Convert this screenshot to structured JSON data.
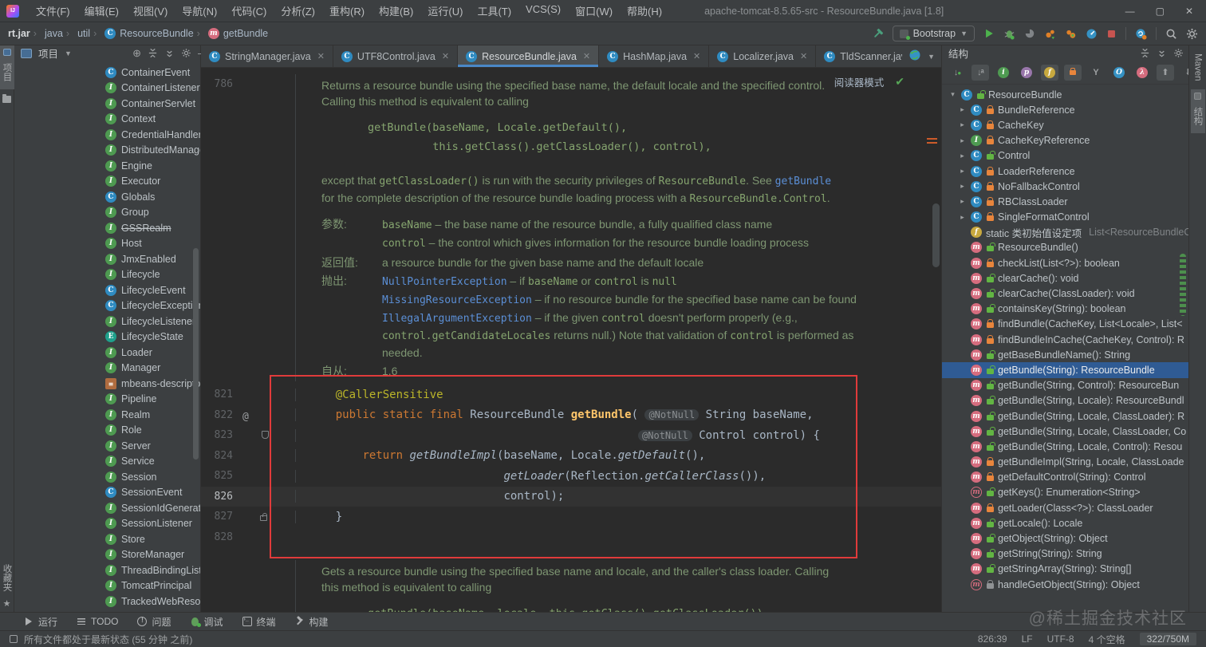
{
  "window": {
    "logo": "IJ",
    "menus": [
      "文件(F)",
      "编辑(E)",
      "视图(V)",
      "导航(N)",
      "代码(C)",
      "分析(Z)",
      "重构(R)",
      "构建(B)",
      "运行(U)",
      "工具(T)",
      "VCS(S)",
      "窗口(W)",
      "帮助(H)"
    ],
    "title": "apache-tomcat-8.5.65-src - ResourceBundle.java [1.8]",
    "controls": {
      "minimize": "—",
      "maximize": "▢",
      "close": "✕"
    }
  },
  "navbar": {
    "crumbs": [
      {
        "label": "rt.jar",
        "icon": ""
      },
      {
        "label": "java",
        "icon": ""
      },
      {
        "label": "util",
        "icon": ""
      },
      {
        "label": "ResourceBundle",
        "icon": "cls"
      },
      {
        "label": "getBundle",
        "icon": "mth"
      }
    ],
    "run_config": "Bootstrap"
  },
  "left_stripe": {
    "project": "项目",
    "favorites": "收藏夹"
  },
  "right_stripe": {
    "maven": "Maven",
    "structure": "结构"
  },
  "project_panel": {
    "title": "项目"
  },
  "project_tree": {
    "items": [
      {
        "label": "ContainerEvent",
        "kind": "cls"
      },
      {
        "label": "ContainerListener",
        "kind": "ifc"
      },
      {
        "label": "ContainerServlet",
        "kind": "ifc"
      },
      {
        "label": "Context",
        "kind": "ifc"
      },
      {
        "label": "CredentialHandler",
        "kind": "ifc"
      },
      {
        "label": "DistributedManager",
        "kind": "ifc"
      },
      {
        "label": "Engine",
        "kind": "ifc"
      },
      {
        "label": "Executor",
        "kind": "ifc"
      },
      {
        "label": "Globals",
        "kind": "cls"
      },
      {
        "label": "Group",
        "kind": "ifc"
      },
      {
        "label": "GSSRealm",
        "kind": "ifc",
        "deprecated": true
      },
      {
        "label": "Host",
        "kind": "ifc"
      },
      {
        "label": "JmxEnabled",
        "kind": "ifc"
      },
      {
        "label": "Lifecycle",
        "kind": "ifc"
      },
      {
        "label": "LifecycleEvent",
        "kind": "cls"
      },
      {
        "label": "LifecycleException",
        "kind": "cls"
      },
      {
        "label": "LifecycleListener",
        "kind": "ifc"
      },
      {
        "label": "LifecycleState",
        "kind": "enm"
      },
      {
        "label": "Loader",
        "kind": "ifc"
      },
      {
        "label": "Manager",
        "kind": "ifc"
      },
      {
        "label": "mbeans-descriptors",
        "kind": "xml"
      },
      {
        "label": "Pipeline",
        "kind": "ifc"
      },
      {
        "label": "Realm",
        "kind": "ifc"
      },
      {
        "label": "Role",
        "kind": "ifc"
      },
      {
        "label": "Server",
        "kind": "ifc"
      },
      {
        "label": "Service",
        "kind": "ifc"
      },
      {
        "label": "Session",
        "kind": "ifc"
      },
      {
        "label": "SessionEvent",
        "kind": "cls"
      },
      {
        "label": "SessionIdGenerator",
        "kind": "ifc"
      },
      {
        "label": "SessionListener",
        "kind": "ifc"
      },
      {
        "label": "Store",
        "kind": "ifc"
      },
      {
        "label": "StoreManager",
        "kind": "ifc"
      },
      {
        "label": "ThreadBindingListener",
        "kind": "ifc"
      },
      {
        "label": "TomcatPrincipal",
        "kind": "ifc"
      },
      {
        "label": "TrackedWebResource",
        "kind": "ifc"
      }
    ]
  },
  "tabs": {
    "items": [
      {
        "label": "StringManager.java",
        "active": false
      },
      {
        "label": "UTF8Control.java",
        "active": false
      },
      {
        "label": "ResourceBundle.java",
        "active": true
      },
      {
        "label": "HashMap.java",
        "active": false
      },
      {
        "label": "Localizer.java",
        "active": false
      },
      {
        "label": "TldScanner.java",
        "active": false
      }
    ]
  },
  "structure_panel": {
    "title": "结构"
  },
  "editor": {
    "reader_mode_label": "阅读器模式",
    "first_line_num": "786",
    "doc1": {
      "para1": [
        {
          "t": "Returns a resource bundle using the specified base name, the default locale and the specified control. Calling this method is equivalent to calling",
          "c": "p"
        }
      ],
      "codeblock": "getBundle(baseName, Locale.getDefault(),\n          this.getClass().getClassLoader(), control),",
      "para2": [
        {
          "t": "except that ",
          "c": "p"
        },
        {
          "t": "getClassLoader()",
          "c": "c"
        },
        {
          "t": " is run with the security privileges of ",
          "c": "p"
        },
        {
          "t": "ResourceBundle",
          "c": "c"
        },
        {
          "t": ". See ",
          "c": "p"
        },
        {
          "t": "getBundle",
          "c": "l"
        },
        {
          "t": " for the complete description of the resource bundle loading process with a ",
          "c": "p"
        },
        {
          "t": "ResourceBundle.Control",
          "c": "c"
        },
        {
          "t": ".",
          "c": "p"
        }
      ],
      "sections": [
        {
          "label": "参数:",
          "lines": [
            [
              {
                "t": "baseName",
                "c": "c"
              },
              {
                "t": " – the base name of the resource bundle, a fully qualified class name",
                "c": "p"
              }
            ],
            [
              {
                "t": "control",
                "c": "c"
              },
              {
                "t": " – the control which gives information for the resource bundle loading process",
                "c": "p"
              }
            ]
          ]
        },
        {
          "label": "返回值:",
          "lines": [
            [
              {
                "t": "a resource bundle for the given base name and the default locale",
                "c": "p"
              }
            ]
          ]
        },
        {
          "label": "抛出:",
          "lines": [
            [
              {
                "t": "NullPointerException",
                "c": "l"
              },
              {
                "t": " – if ",
                "c": "p"
              },
              {
                "t": "baseName",
                "c": "c"
              },
              {
                "t": " or ",
                "c": "p"
              },
              {
                "t": "control",
                "c": "c"
              },
              {
                "t": " is ",
                "c": "p"
              },
              {
                "t": "null",
                "c": "c"
              }
            ],
            [
              {
                "t": "MissingResourceException",
                "c": "l"
              },
              {
                "t": " – if no resource bundle for the specified base name can be found",
                "c": "p"
              }
            ],
            [
              {
                "t": "IllegalArgumentException",
                "c": "l"
              },
              {
                "t": " – if the given ",
                "c": "p"
              },
              {
                "t": "control",
                "c": "c"
              },
              {
                "t": " doesn't perform properly (e.g., ",
                "c": "p"
              },
              {
                "t": "control.getCandidateLocales",
                "c": "c"
              },
              {
                "t": " returns null.) Note that validation of ",
                "c": "p"
              },
              {
                "t": "control",
                "c": "c"
              },
              {
                "t": " is performed as needed.",
                "c": "p"
              }
            ]
          ]
        },
        {
          "label": "自从:",
          "lines": [
            [
              {
                "t": "1.6",
                "c": "p"
              }
            ]
          ]
        }
      ]
    },
    "code": {
      "lines": [
        {
          "num": "821",
          "tokens": [
            {
              "t": "    ",
              "c": "pl"
            },
            {
              "t": "@CallerSensitive",
              "c": "ann"
            }
          ]
        },
        {
          "num": "822",
          "gicon": "at",
          "tokens": [
            {
              "t": "    ",
              "c": "pl"
            },
            {
              "t": "public static final",
              "c": "k"
            },
            {
              "t": " ResourceBundle ",
              "c": "pl"
            },
            {
              "t": "getBundle",
              "c": "m"
            },
            {
              "t": "( ",
              "c": "pl"
            },
            {
              "t": "@NotNull",
              "c": "inlay"
            },
            {
              "t": " String baseName,",
              "c": "pl"
            }
          ]
        },
        {
          "num": "823",
          "gicon": "bm",
          "tokens": [
            {
              "t": "                                                 ",
              "c": "pl"
            },
            {
              "t": "@NotNull",
              "c": "inlay"
            },
            {
              "t": " Control control) {",
              "c": "pl"
            }
          ]
        },
        {
          "num": "824",
          "tokens": [
            {
              "t": "        ",
              "c": "pl"
            },
            {
              "t": "return ",
              "c": "k"
            },
            {
              "t": "getBundleImpl",
              "c": "sm"
            },
            {
              "t": "(baseName, Locale.",
              "c": "pl"
            },
            {
              "t": "getDefault",
              "c": "sm"
            },
            {
              "t": "(),",
              "c": "pl"
            }
          ]
        },
        {
          "num": "825",
          "tokens": [
            {
              "t": "                             ",
              "c": "pl"
            },
            {
              "t": "getLoader",
              "c": "sm"
            },
            {
              "t": "(Reflection.",
              "c": "pl"
            },
            {
              "t": "getCallerClass",
              "c": "sm"
            },
            {
              "t": "()),",
              "c": "pl"
            }
          ]
        },
        {
          "num": "826",
          "current": true,
          "tokens": [
            {
              "t": "                             ",
              "c": "pl"
            },
            {
              "t": "control);",
              "c": "pl"
            }
          ]
        },
        {
          "num": "827",
          "gicon": "lock",
          "tokens": [
            {
              "t": "    }",
              "c": "pl"
            }
          ]
        },
        {
          "num": "828",
          "tokens": []
        }
      ]
    },
    "doc2": {
      "para": [
        {
          "t": "Gets a resource bundle using the specified base name and locale, and the caller's class loader. Calling this method is equivalent to calling",
          "c": "p"
        }
      ],
      "codeblock": "getBundle(baseName, locale, this.getClass().getClassLoader()),"
    }
  },
  "structure_tree": {
    "rows": [
      {
        "a": "exp",
        "k": "cls",
        "vis": "pub",
        "label": "ResourceBundle"
      },
      {
        "a": "col",
        "lvl": 2,
        "k": "cls",
        "vis": "priv",
        "label": "BundleReference"
      },
      {
        "a": "col",
        "lvl": 2,
        "k": "cls",
        "vis": "priv",
        "label": "CacheKey"
      },
      {
        "a": "col",
        "lvl": 2,
        "k": "ifc",
        "vis": "priv",
        "label": "CacheKeyReference"
      },
      {
        "a": "col",
        "lvl": 2,
        "k": "cls",
        "vis": "pub",
        "label": "Control"
      },
      {
        "a": "col",
        "lvl": 2,
        "k": "cls",
        "vis": "priv",
        "label": "LoaderReference"
      },
      {
        "a": "col",
        "lvl": 2,
        "k": "cls",
        "vis": "priv",
        "label": "NoFallbackControl"
      },
      {
        "a": "col",
        "lvl": 2,
        "k": "cls",
        "vis": "priv",
        "label": "RBClassLoader"
      },
      {
        "a": "col",
        "lvl": 2,
        "k": "cls",
        "vis": "priv",
        "label": "SingleFormatControl"
      },
      {
        "a": "",
        "lvl": 2,
        "k": "ini",
        "vis": "none",
        "label": "static 类初始值设定项",
        "suffix": "List<ResourceBundleC"
      },
      {
        "a": "",
        "lvl": 2,
        "k": "mth",
        "vis": "pub",
        "label": "ResourceBundle()"
      },
      {
        "a": "",
        "lvl": 2,
        "k": "mth",
        "vis": "priv",
        "label": "checkList(List<?>): boolean"
      },
      {
        "a": "",
        "lvl": 2,
        "k": "mth",
        "vis": "pub",
        "label": "clearCache(): void"
      },
      {
        "a": "",
        "lvl": 2,
        "k": "mth",
        "vis": "pub",
        "label": "clearCache(ClassLoader): void"
      },
      {
        "a": "",
        "lvl": 2,
        "k": "mth",
        "vis": "pub",
        "label": "containsKey(String): boolean"
      },
      {
        "a": "",
        "lvl": 2,
        "k": "mth",
        "vis": "priv",
        "label": "findBundle(CacheKey, List<Locale>, List<"
      },
      {
        "a": "",
        "lvl": 2,
        "k": "mth",
        "vis": "priv",
        "label": "findBundleInCache(CacheKey, Control): R"
      },
      {
        "a": "",
        "lvl": 2,
        "k": "mth",
        "vis": "pub",
        "label": "getBaseBundleName(): String"
      },
      {
        "a": "",
        "lvl": 2,
        "k": "mth",
        "vis": "pub",
        "label": "getBundle(String): ResourceBundle",
        "sel": true
      },
      {
        "a": "",
        "lvl": 2,
        "k": "mth",
        "vis": "pub",
        "label": "getBundle(String, Control): ResourceBun"
      },
      {
        "a": "",
        "lvl": 2,
        "k": "mth",
        "vis": "pub",
        "label": "getBundle(String, Locale): ResourceBundl"
      },
      {
        "a": "",
        "lvl": 2,
        "k": "mth",
        "vis": "pub",
        "label": "getBundle(String, Locale, ClassLoader): R"
      },
      {
        "a": "",
        "lvl": 2,
        "k": "mth",
        "vis": "pub",
        "label": "getBundle(String, Locale, ClassLoader, Co"
      },
      {
        "a": "",
        "lvl": 2,
        "k": "mth",
        "vis": "pub",
        "label": "getBundle(String, Locale, Control): Resou"
      },
      {
        "a": "",
        "lvl": 2,
        "k": "mth",
        "vis": "priv",
        "label": "getBundleImpl(String, Locale, ClassLoade"
      },
      {
        "a": "",
        "lvl": 2,
        "k": "mth",
        "vis": "priv",
        "label": "getDefaultControl(String): Control"
      },
      {
        "a": "",
        "lvl": 2,
        "k": "mab",
        "vis": "pub",
        "label": "getKeys(): Enumeration<String>"
      },
      {
        "a": "",
        "lvl": 2,
        "k": "mth",
        "vis": "priv",
        "label": "getLoader(Class<?>): ClassLoader"
      },
      {
        "a": "",
        "lvl": 2,
        "k": "mth",
        "vis": "pub",
        "label": "getLocale(): Locale"
      },
      {
        "a": "",
        "lvl": 2,
        "k": "mth",
        "vis": "pub",
        "label": "getObject(String): Object"
      },
      {
        "a": "",
        "lvl": 2,
        "k": "mth",
        "vis": "pub",
        "label": "getString(String): String"
      },
      {
        "a": "",
        "lvl": 2,
        "k": "mth",
        "vis": "pub",
        "label": "getStringArray(String): String[]"
      },
      {
        "a": "",
        "lvl": 2,
        "k": "mab",
        "vis": "prot",
        "label": "handleGetObject(String): Object"
      }
    ]
  },
  "bottom_bar": {
    "items": [
      {
        "icon": "run",
        "label": "运行"
      },
      {
        "icon": "todo",
        "label": "TODO"
      },
      {
        "icon": "problem",
        "label": "问题"
      },
      {
        "icon": "debug",
        "label": "调试"
      },
      {
        "icon": "terminal",
        "label": "终端"
      },
      {
        "icon": "build",
        "label": "构建"
      }
    ]
  },
  "status_bar": {
    "left_text": "所有文件都处于最新状态 (55 分钟 之前)",
    "right_items": [
      {
        "label": "826:39",
        "pill": false
      },
      {
        "label": "LF",
        "pill": false
      },
      {
        "label": "UTF-8",
        "pill": false
      },
      {
        "label": "4 个空格",
        "pill": false
      },
      {
        "label": "322/750M",
        "pill": true
      }
    ]
  },
  "watermark": "@稀土掘金技术社区",
  "colors": {
    "accent_blue": "#4A88C7",
    "red_annotation_box": "#E03B3B",
    "selection_blue": "#2F5B94",
    "keyword_orange": "#CC7832",
    "annotation_yellow": "#BBB529",
    "method_yellow": "#FFC66B",
    "doc_green": "#7E9672",
    "link_blue": "#5B8FD6",
    "editor_bg": "#2B2B2B",
    "panel_bg": "#3C3F41"
  }
}
